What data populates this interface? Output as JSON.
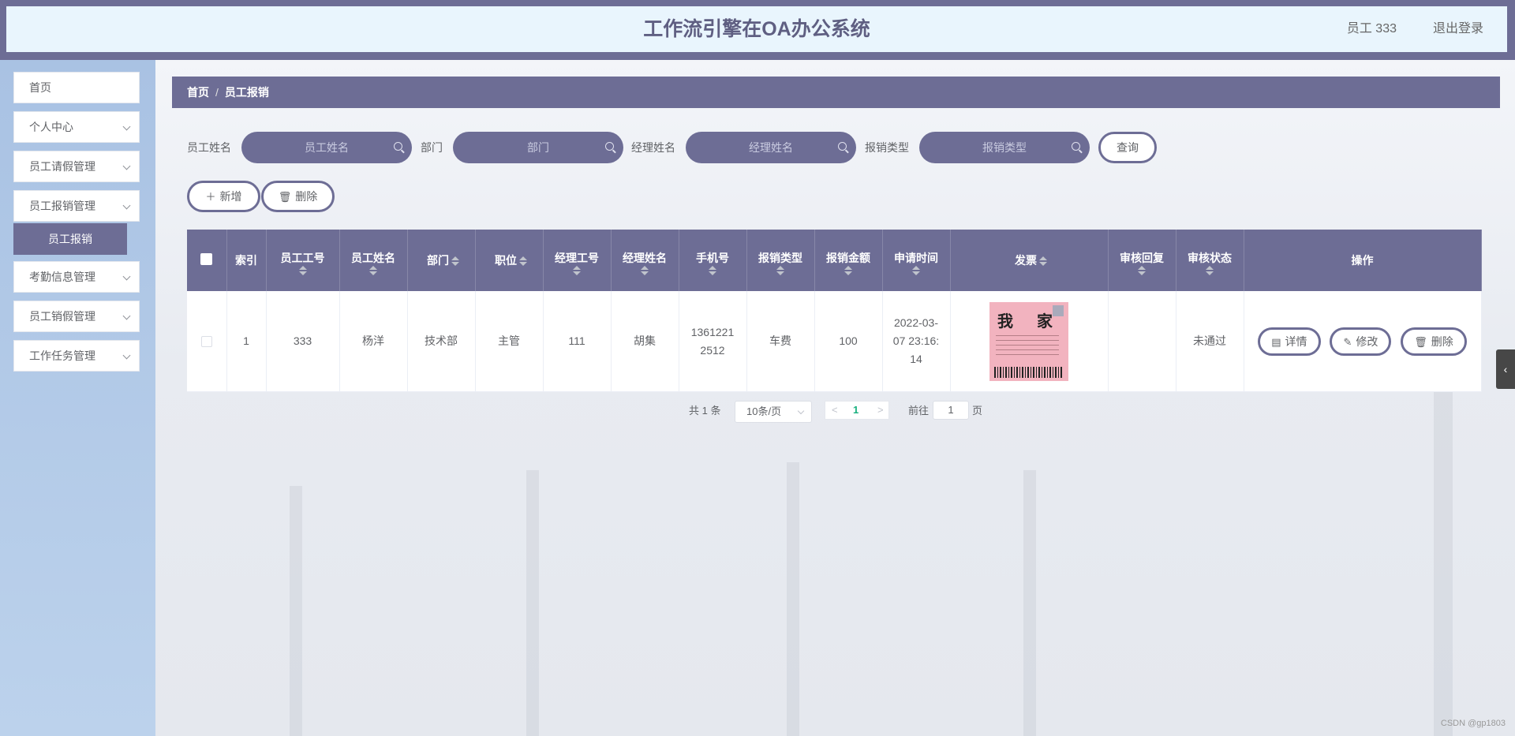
{
  "header": {
    "title": "工作流引擎在OA办公系统",
    "user": "员工 333",
    "logout": "退出登录"
  },
  "sidebar": {
    "items": [
      {
        "label": "首页"
      },
      {
        "label": "个人中心"
      },
      {
        "label": "员工请假管理"
      },
      {
        "label": "员工报销管理"
      },
      {
        "label": "考勤信息管理"
      },
      {
        "label": "员工销假管理"
      },
      {
        "label": "工作任务管理"
      }
    ],
    "active_sub": "员工报销"
  },
  "breadcrumb": {
    "home": "首页",
    "sep": "/",
    "current": "员工报销"
  },
  "filters": [
    {
      "label": "员工姓名",
      "placeholder": "员工姓名"
    },
    {
      "label": "部门",
      "placeholder": "部门"
    },
    {
      "label": "经理姓名",
      "placeholder": "经理姓名"
    },
    {
      "label": "报销类型",
      "placeholder": "报销类型"
    }
  ],
  "buttons": {
    "query": "查询",
    "add": "新增",
    "delete": "删除"
  },
  "table": {
    "columns": [
      "索引",
      "员工工号",
      "员工姓名",
      "部门",
      "职位",
      "经理工号",
      "经理姓名",
      "手机号",
      "报销类型",
      "报销金额",
      "申请时间",
      "发票",
      "审核回复",
      "审核状态",
      "操作"
    ],
    "rows": [
      {
        "index": "1",
        "emp_id": "333",
        "emp_name": "杨洋",
        "dept": "技术部",
        "position": "主管",
        "mgr_id": "111",
        "mgr_name": "胡集",
        "phone_1": "1361221",
        "phone_2": "2512",
        "type": "车费",
        "amount": "100",
        "time_1": "2022-03-",
        "time_2": "07 23:16:",
        "time_3": "14",
        "invoice_text_1": "我",
        "invoice_text_2": "家",
        "reply": "",
        "status": "未通过",
        "actions": {
          "detail": "详情",
          "edit": "修改",
          "delete": "删除"
        }
      }
    ]
  },
  "pagination": {
    "total": "共 1 条",
    "page_size": "10条/页",
    "prev": "<",
    "current": "1",
    "next": ">",
    "goto": "前往",
    "goto_value": "1",
    "page_unit": "页"
  },
  "side_toggle": "‹",
  "watermark": "CSDN @gp1803"
}
